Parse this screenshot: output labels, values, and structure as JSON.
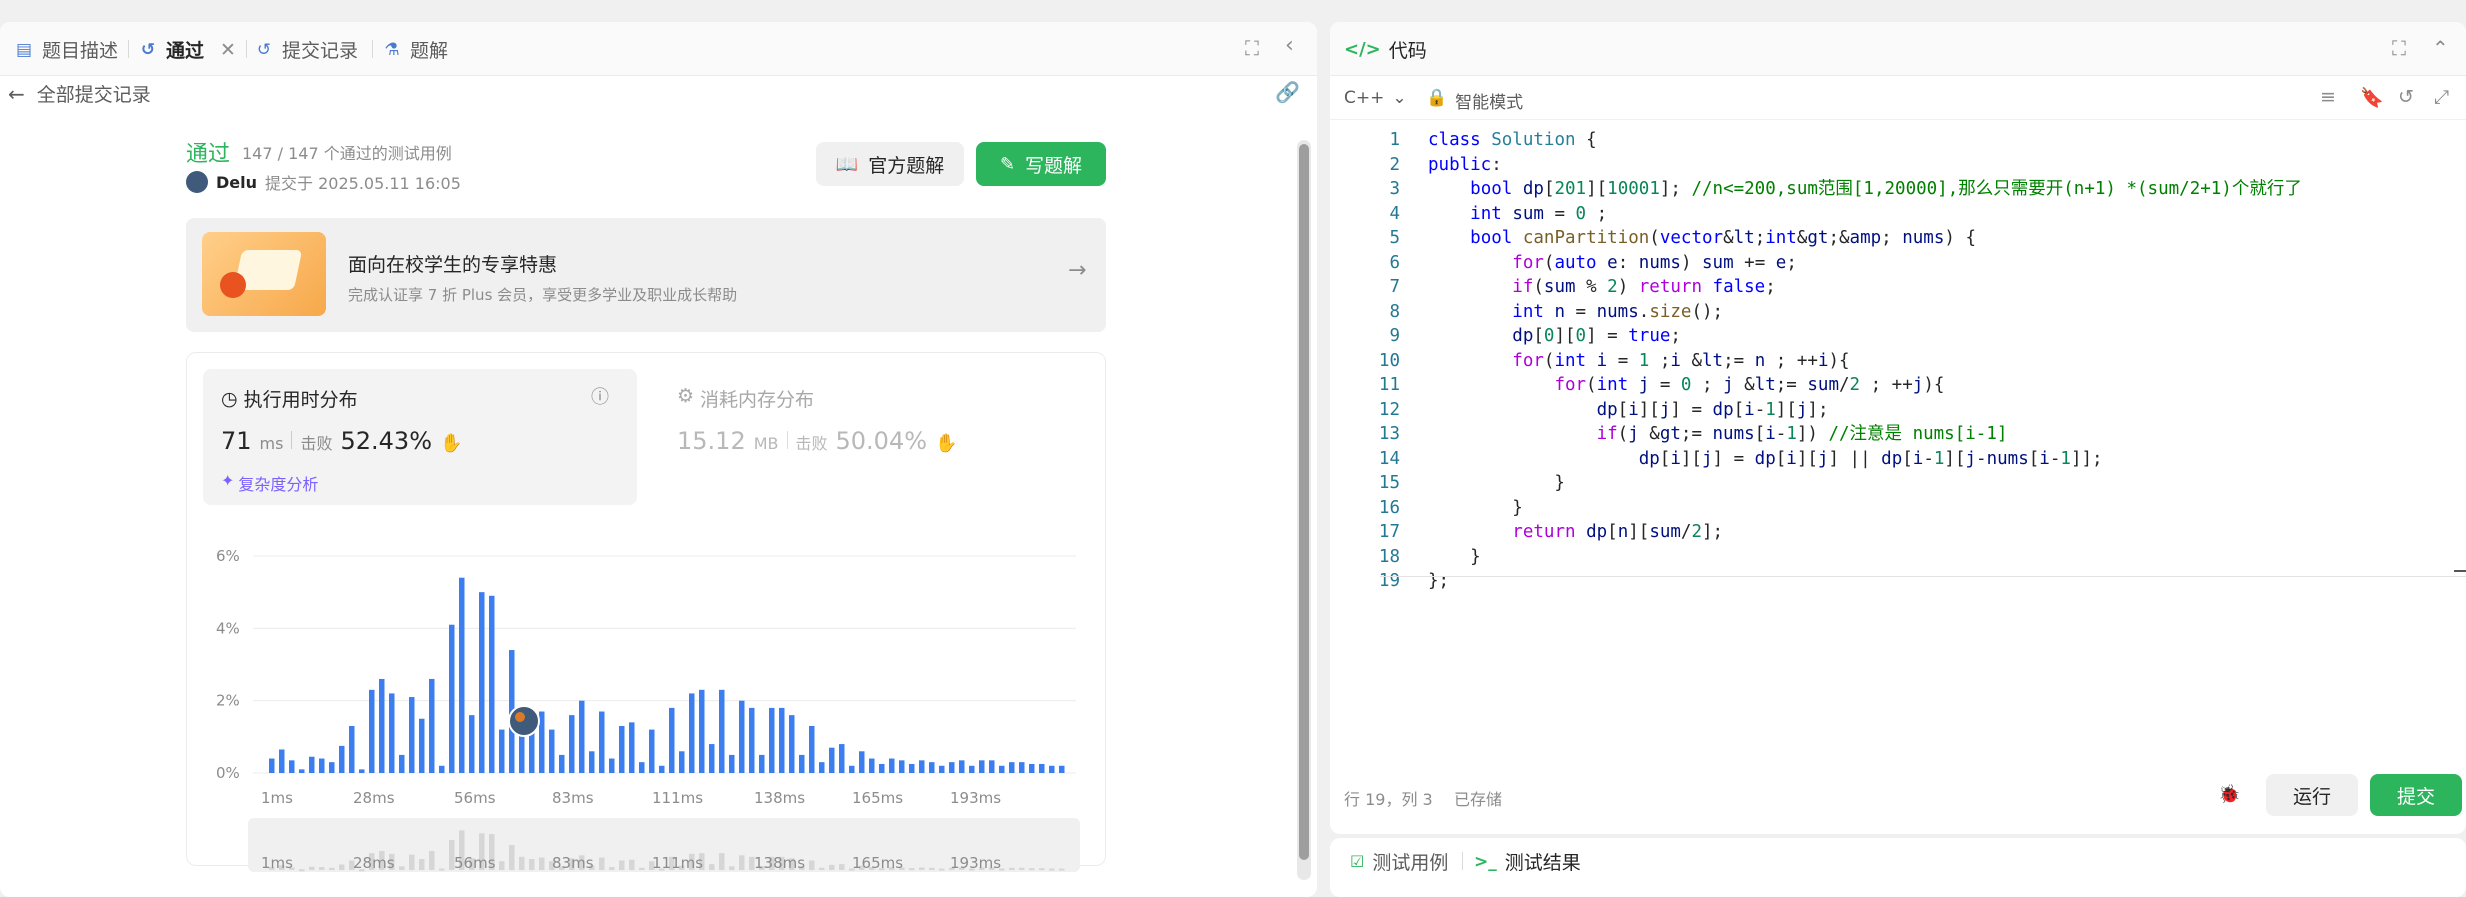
{
  "left_tabs": [
    {
      "label": "题目描述",
      "icon": "doc-icon"
    },
    {
      "label": "通过",
      "icon": "history-icon"
    },
    {
      "label": "提交记录",
      "icon": "history-icon"
    },
    {
      "label": "题解",
      "icon": "flask-icon"
    }
  ],
  "back_label": "全部提交记录",
  "result": {
    "status": "通过",
    "testcases": "147 / 147 个通过的测试用例",
    "user": "Delu",
    "submitted_at": "提交于 2025.05.11 16:05"
  },
  "buttons": {
    "official": "官方题解",
    "write": "写题解"
  },
  "promo": {
    "title": "面向在校学生的专享特惠",
    "subtitle": "完成认证享 7 折 Plus 会员，享受更多学业及职业成长帮助"
  },
  "runtime": {
    "title": "执行用时分布",
    "value": "71",
    "unit": "ms",
    "beats_label": "击败",
    "beats": "52.43%",
    "complexity": "复杂度分析"
  },
  "memory": {
    "title": "消耗内存分布",
    "value": "15.12",
    "unit": "MB",
    "beats_label": "击败",
    "beats": "50.04%"
  },
  "chart_data": {
    "type": "bar",
    "ylim": [
      0,
      6
    ],
    "y_ticks": [
      "6%",
      "4%",
      "2%",
      "0%"
    ],
    "x_ticks": [
      "1ms",
      "28ms",
      "56ms",
      "83ms",
      "111ms",
      "138ms",
      "165ms",
      "193ms"
    ],
    "values": [
      0.4,
      0.65,
      0.35,
      0.1,
      0.45,
      0.4,
      0.3,
      0.75,
      1.3,
      0.1,
      2.3,
      2.6,
      2.2,
      0.5,
      2.1,
      1.5,
      2.6,
      0.2,
      4.1,
      5.4,
      1.6,
      5.0,
      4.9,
      1.2,
      3.4,
      1.8,
      1.5,
      1.7,
      1.2,
      0.5,
      1.6,
      2.0,
      0.6,
      1.7,
      0.4,
      1.3,
      1.4,
      0.3,
      1.2,
      0.2,
      1.8,
      0.6,
      2.2,
      2.3,
      0.8,
      2.3,
      0.5,
      2.0,
      1.8,
      0.5,
      1.8,
      1.8,
      1.6,
      0.5,
      1.3,
      0.3,
      0.7,
      0.8,
      0.2,
      0.6,
      0.4,
      0.25,
      0.4,
      0.35,
      0.25,
      0.35,
      0.3,
      0.2,
      0.3,
      0.35,
      0.2,
      0.35,
      0.35,
      0.2,
      0.3,
      0.3,
      0.25,
      0.25,
      0.2,
      0.2
    ]
  },
  "editor": {
    "title": "代码",
    "language": "C++",
    "mode": "智能模式",
    "status_pos": "行 19，列 3",
    "status_saved": "已存储",
    "run": "运行",
    "submit": "提交"
  },
  "code_lines": [
    "class Solution {",
    "public:",
    "    bool dp[201][10001]; //n<=200,sum范围[1,20000],那么只需要开(n+1) *(sum/2+1)个就行了",
    "    int sum = 0 ;",
    "    bool canPartition(vector<int>& nums) {",
    "        for(auto e: nums) sum += e;",
    "        if(sum % 2) return false;",
    "        int n = nums.size();",
    "        dp[0][0] = true;",
    "        for(int i = 1 ;i <= n ; ++i){",
    "            for(int j = 0 ; j <= sum/2 ; ++j){",
    "                dp[i][j] = dp[i-1][j];",
    "                if(j >= nums[i-1]) //注意是 nums[i-1]",
    "                    dp[i][j] = dp[i][j] || dp[i-1][j-nums[i-1]];",
    "            }",
    "        }",
    "        return dp[n][sum/2];",
    "    }",
    "};"
  ],
  "bottom_tabs": [
    "测试用例",
    "测试结果"
  ]
}
